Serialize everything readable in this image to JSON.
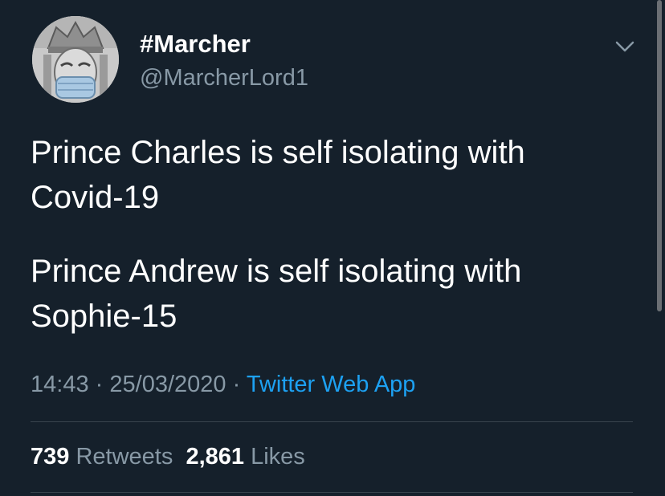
{
  "user": {
    "display_name": "#Marcher",
    "handle": "@MarcherLord1",
    "avatar_icon": "avatar-image"
  },
  "menu": {
    "icon": "chevron-down-icon"
  },
  "tweet": {
    "lines": [
      "Prince Charles is self isolating with Covid-19",
      "Prince Andrew is self isolating with Sophie-15"
    ],
    "time": "14:43",
    "date": "25/03/2020",
    "separator": "·",
    "source": "Twitter Web App"
  },
  "stats": {
    "retweets_count": "739",
    "retweets_label": "Retweets",
    "likes_count": "2,861",
    "likes_label": "Likes"
  },
  "colors": {
    "background": "#15202b",
    "text": "#ffffff",
    "secondary": "#8899a6",
    "accent": "#1da1f2",
    "divider": "#38444d"
  }
}
